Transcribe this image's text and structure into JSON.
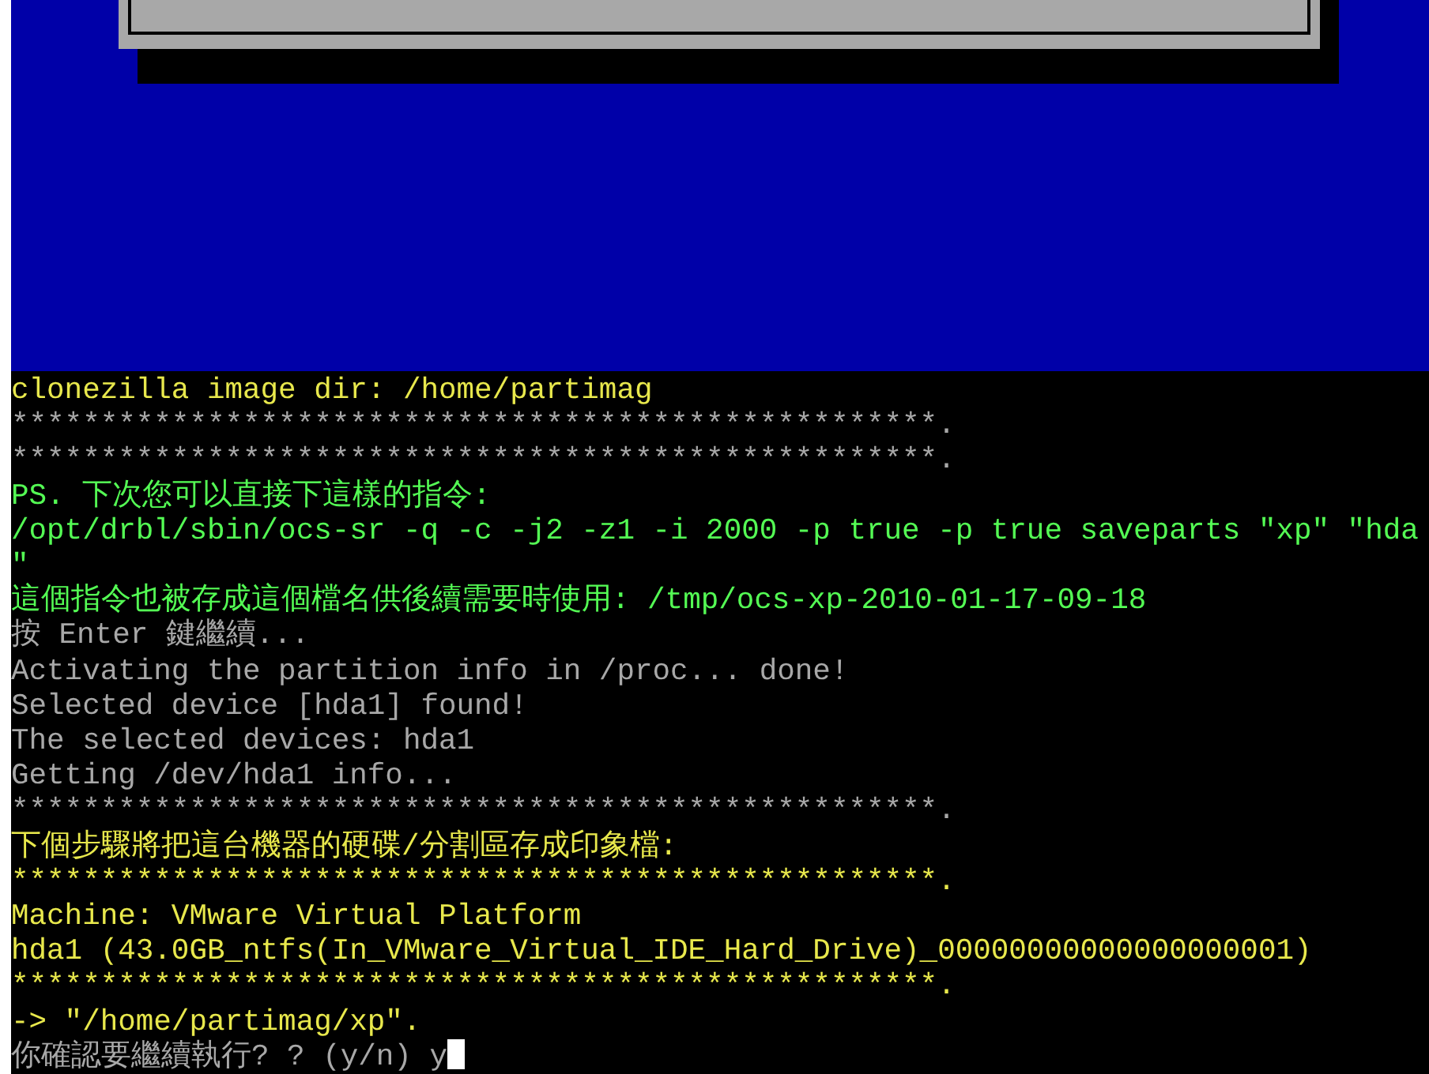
{
  "terminal": {
    "lines": [
      {
        "text": "clonezilla image dir: /home/partimag",
        "color": "#e8e84c",
        "cursor": false
      },
      {
        "text": "****************************************************.",
        "color": "#a8a8a8",
        "cursor": false
      },
      {
        "text": "****************************************************.",
        "color": "#a8a8a8",
        "cursor": false
      },
      {
        "text": "PS. 下次您可以直接下這樣的指令:",
        "color": "#54fc54",
        "cursor": false
      },
      {
        "text": "/opt/drbl/sbin/ocs-sr -q -c -j2 -z1 -i 2000 -p true -p true saveparts \"xp\" \"hda",
        "color": "#54fc54",
        "cursor": false
      },
      {
        "text": "\"",
        "color": "#54fc54",
        "cursor": false
      },
      {
        "text": "這個指令也被存成這個檔名供後續需要時使用: /tmp/ocs-xp-2010-01-17-09-18",
        "color": "#54fc54",
        "cursor": false
      },
      {
        "text": "按 Enter 鍵繼續...",
        "color": "#a8a8a8",
        "cursor": false
      },
      {
        "text": "Activating the partition info in /proc... done!",
        "color": "#a8a8a8",
        "cursor": false
      },
      {
        "text": "Selected device [hda1] found!",
        "color": "#a8a8a8",
        "cursor": false
      },
      {
        "text": "The selected devices: hda1",
        "color": "#a8a8a8",
        "cursor": false
      },
      {
        "text": "Getting /dev/hda1 info...",
        "color": "#a8a8a8",
        "cursor": false
      },
      {
        "text": "****************************************************.",
        "color": "#a8a8a8",
        "cursor": false
      },
      {
        "text": "下個步驟將把這台機器的硬碟/分割區存成印象檔:",
        "color": "#e8e84c",
        "cursor": false
      },
      {
        "text": "****************************************************.",
        "color": "#e8e84c",
        "cursor": false
      },
      {
        "text": "Machine: VMware Virtual Platform",
        "color": "#e8e84c",
        "cursor": false
      },
      {
        "text": "hda1 (43.0GB_ntfs(In_VMware_Virtual_IDE_Hard_Drive)_00000000000000000001)",
        "color": "#e8e84c",
        "cursor": false
      },
      {
        "text": "****************************************************.",
        "color": "#e8e84c",
        "cursor": false
      },
      {
        "text": "-> \"/home/partimag/xp\".",
        "color": "#e8e84c",
        "cursor": false
      },
      {
        "text": "你確認要繼續執行? ? (y/n) y",
        "color": "#a8a8a8",
        "cursor": true
      }
    ]
  }
}
